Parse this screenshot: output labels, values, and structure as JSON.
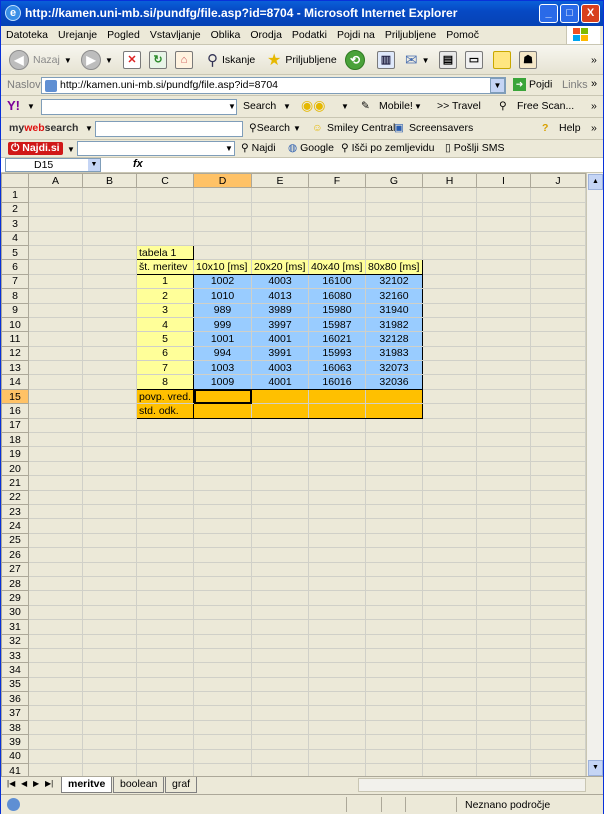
{
  "window": {
    "title": "http://kamen.uni-mb.si/pundfg/file.asp?id=8704 - Microsoft Internet Explorer",
    "buttons": [
      "_",
      "□",
      "X"
    ]
  },
  "menu": [
    "Datoteka",
    "Urejanje",
    "Pogled",
    "Vstavljanje",
    "Oblika",
    "Orodja",
    "Podatki",
    "Pojdi na",
    "Priljubljene",
    "Pomoč"
  ],
  "toolbar": {
    "back": "Nazaj",
    "search": "Iskanje",
    "favorites": "Priljubljene",
    "overflow": "»"
  },
  "address": {
    "label": "Naslov",
    "url": "http://kamen.uni-mb.si/pundfg/file.asp?id=8704",
    "go": "Pojdi",
    "links": "Links"
  },
  "yahoo_bar": {
    "search": "Search",
    "mobile": "Mobile!",
    "travel": ">> Travel",
    "free_scan": "Free Scan..."
  },
  "mywebsearch_bar": {
    "brand_a": "my",
    "brand_b": "web",
    "brand_c": "search",
    "search": "Search",
    "smiley": "Smiley Central",
    "screensavers": "Screensavers",
    "help": "Help"
  },
  "najdi_bar": {
    "brand": "Najdi.si",
    "najdi": "Najdi",
    "google": "Google",
    "isci": "Išči po zemljevidu",
    "sms": "Pošlji SMS"
  },
  "formula_bar": {
    "namebox": "D15",
    "fx": "fx"
  },
  "sheet": {
    "columns": [
      "A",
      "B",
      "C",
      "D",
      "E",
      "F",
      "G",
      "H",
      "I",
      "J"
    ],
    "selected_column": "D",
    "selected_row": 15,
    "table_title": "tabela 1",
    "headers": [
      "št. meritev",
      "10x10 [ms]",
      "20x20 [ms]",
      "40x40 [ms]",
      "80x80 [ms]"
    ],
    "rows": [
      [
        "1",
        "1002",
        "4003",
        "16100",
        "32102"
      ],
      [
        "2",
        "1010",
        "4013",
        "16080",
        "32160"
      ],
      [
        "3",
        "989",
        "3989",
        "15980",
        "31940"
      ],
      [
        "4",
        "999",
        "3997",
        "15987",
        "31982"
      ],
      [
        "5",
        "1001",
        "4001",
        "16021",
        "32128"
      ],
      [
        "6",
        "994",
        "3991",
        "15993",
        "31983"
      ],
      [
        "7",
        "1003",
        "4003",
        "16063",
        "32073"
      ],
      [
        "8",
        "1009",
        "4001",
        "16016",
        "32036"
      ]
    ],
    "summary": [
      "povp. vred.",
      "std. odk."
    ],
    "total_rows": 41
  },
  "tabs": [
    "meritve",
    "boolean",
    "graf"
  ],
  "active_tab": "meritve",
  "status": {
    "zone": "Neznano področje"
  }
}
